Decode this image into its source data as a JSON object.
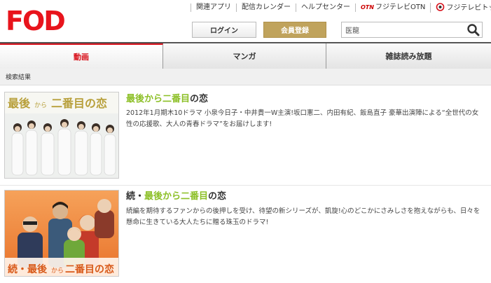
{
  "header": {
    "logo_text": "FOD",
    "util_links": [
      "関連アプリ",
      "配信カレンダー",
      "ヘルプセンター",
      "フジテレビOTN",
      "フジテレビトップ"
    ],
    "otn_badge": "OTN",
    "login_label": "ログイン",
    "register_label": "会員登録",
    "search_value": "医龍"
  },
  "tabs": [
    {
      "label": "動画",
      "active": true
    },
    {
      "label": "マンガ",
      "active": false
    },
    {
      "label": "雑誌読み放題",
      "active": false
    }
  ],
  "results_label": "検索結果",
  "results": [
    {
      "title_green": "最後から二番目",
      "title_rest": "の恋",
      "description": "2012年1月期木10ドラマ 小泉今日子・中井貴一W主演!坂口憲二、内田有紀、飯島直子 豪華出演陣による“全世代の女性の応援歌、大人の青春ドラマ”をお届けします!",
      "thumb_text": [
        "最後",
        "から",
        "二番目の恋"
      ]
    },
    {
      "title_prefix": "続・",
      "title_green": "最後から二番目",
      "title_rest": "の恋",
      "description": "続編を期待するファンからの後押しを受け、待望の新シリーズが、凱旋!心のどこかにさみしさを抱えながらも、日々を懸命に生きている大人たちに贈る珠玉のドラマ!",
      "thumb_text": [
        "続・最後",
        "から",
        "二番目の恋"
      ]
    }
  ],
  "colors": {
    "brand_red": "#d8101a",
    "accent_green": "#8cbf26",
    "register_gold": "#c0a35c"
  }
}
